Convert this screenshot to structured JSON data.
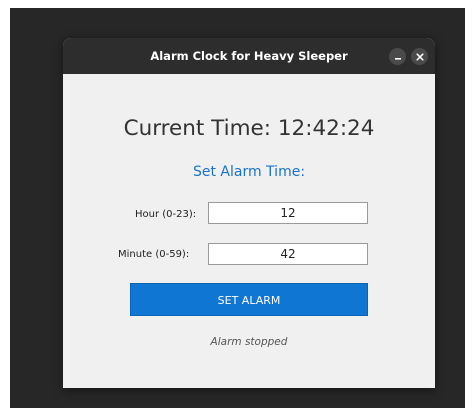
{
  "window": {
    "title": "Alarm Clock for Heavy Sleeper",
    "minimize_icon": "minimize-icon",
    "close_icon": "close-icon"
  },
  "clock": {
    "current_time": "Current Time: 12:42:24"
  },
  "alarm": {
    "heading": "Set Alarm Time:",
    "hour_label": "Hour (0-23):",
    "hour_value": "12",
    "minute_label": "Minute (0-59):",
    "minute_value": "42",
    "set_button_label": "SET ALARM",
    "status": "Alarm stopped"
  },
  "colors": {
    "accent": "#0f76d4",
    "heading": "#1a73c8",
    "titlebar": "#2d2d2d",
    "window_bg": "#f0f0f0",
    "desktop_bg": "#272727"
  }
}
